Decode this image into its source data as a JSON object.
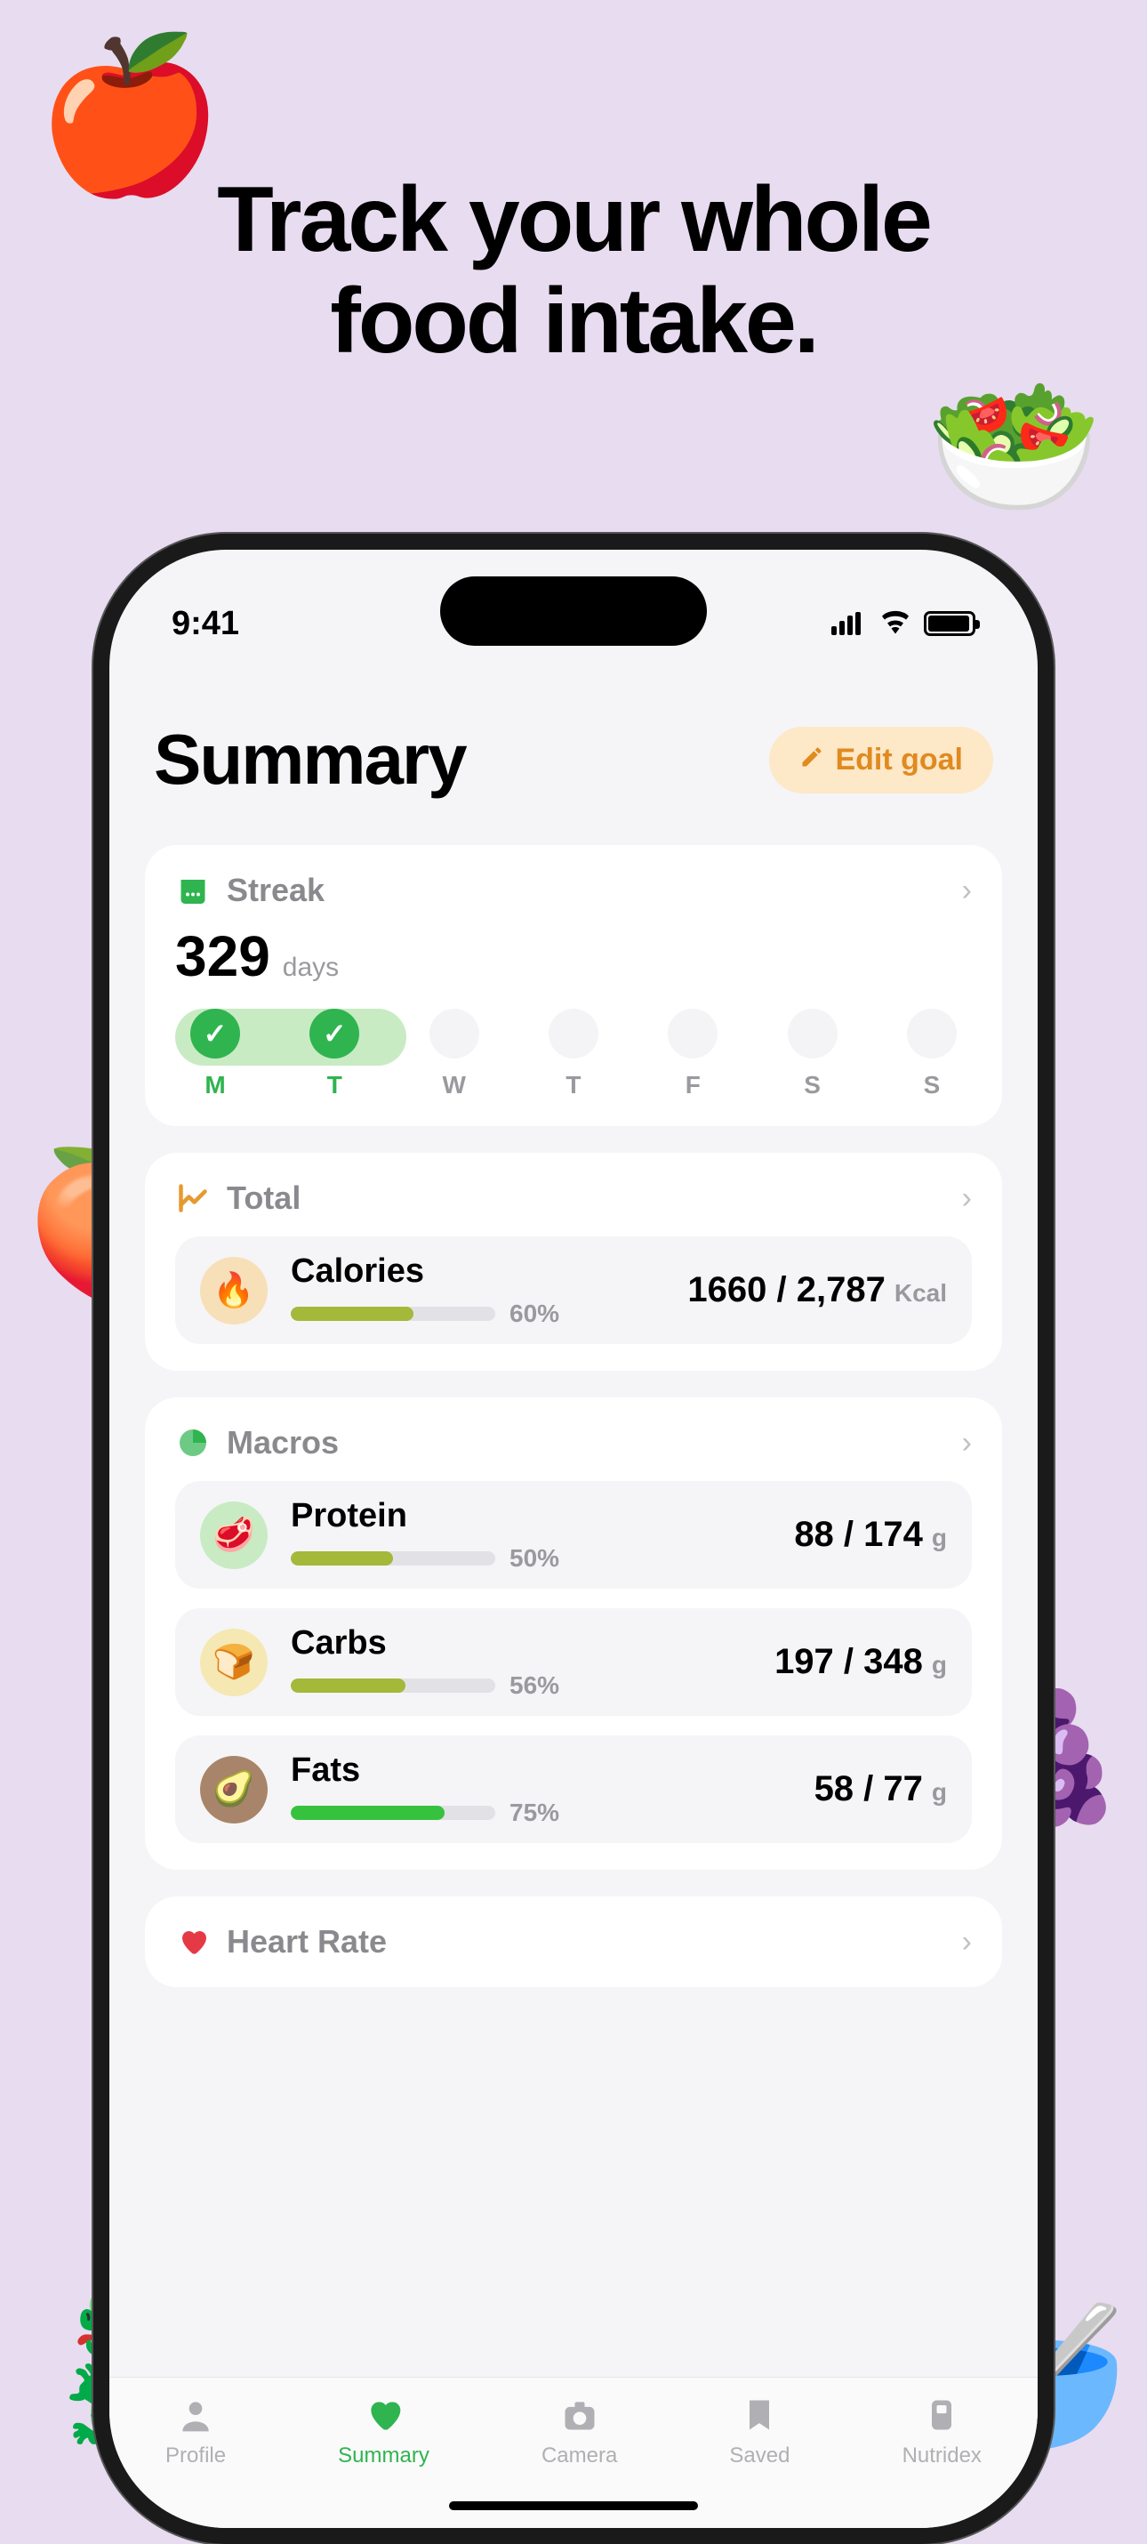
{
  "marketing": {
    "headline_l1": "Track your whole",
    "headline_l2": "food intake."
  },
  "status": {
    "time": "9:41"
  },
  "header": {
    "title": "Summary",
    "edit_goal_label": "Edit goal"
  },
  "streak": {
    "section_label": "Streak",
    "count": "329",
    "unit": "days",
    "days": [
      {
        "label": "M",
        "done": true
      },
      {
        "label": "T",
        "done": true
      },
      {
        "label": "W",
        "done": false
      },
      {
        "label": "T",
        "done": false
      },
      {
        "label": "F",
        "done": false
      },
      {
        "label": "S",
        "done": false
      },
      {
        "label": "S",
        "done": false
      }
    ]
  },
  "total": {
    "section_label": "Total",
    "calories": {
      "name": "Calories",
      "value": "1660 / 2,787",
      "unit": "Kcal",
      "pct_label": "60%",
      "pct": 60
    }
  },
  "macros": {
    "section_label": "Macros",
    "items": [
      {
        "name": "Protein",
        "value": "88 / 174",
        "unit": "g",
        "pct_label": "50%",
        "pct": 50,
        "icon_bg": "bg-green",
        "emoji": "🥩",
        "fill": "fill-olive"
      },
      {
        "name": "Carbs",
        "value": "197 / 348",
        "unit": "g",
        "pct_label": "56%",
        "pct": 56,
        "icon_bg": "bg-yellow",
        "emoji": "🍞",
        "fill": "fill-olive"
      },
      {
        "name": "Fats",
        "value": "58 / 77",
        "unit": "g",
        "pct_label": "75%",
        "pct": 75,
        "icon_bg": "bg-brown",
        "emoji": "🥑",
        "fill": "fill-green"
      }
    ]
  },
  "heart": {
    "section_label": "Heart Rate"
  },
  "tabs": [
    {
      "label": "Profile",
      "active": false
    },
    {
      "label": "Summary",
      "active": true
    },
    {
      "label": "Camera",
      "active": false
    },
    {
      "label": "Saved",
      "active": false
    },
    {
      "label": "Nutridex",
      "active": false
    }
  ]
}
